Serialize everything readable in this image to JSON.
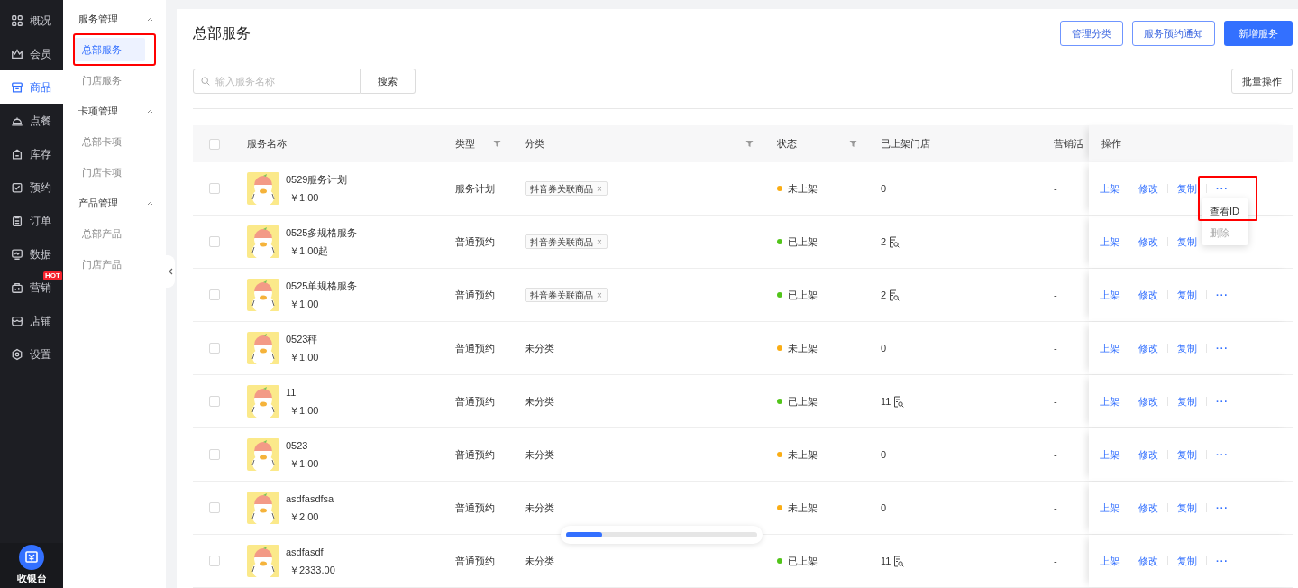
{
  "sidebar": {
    "items": [
      {
        "label": "概况",
        "kind": "grid",
        "selected": false
      },
      {
        "label": "会员",
        "kind": "crown",
        "selected": false
      },
      {
        "label": "商品",
        "kind": "store",
        "selected": true
      },
      {
        "label": "点餐",
        "kind": "bell",
        "selected": false
      },
      {
        "label": "库存",
        "kind": "box",
        "selected": false
      },
      {
        "label": "预约",
        "kind": "calendar",
        "selected": false
      },
      {
        "label": "订单",
        "kind": "clipboard",
        "selected": false
      },
      {
        "label": "数据",
        "kind": "monitor",
        "selected": false
      },
      {
        "label": "营销",
        "kind": "bag",
        "selected": false,
        "badge": "HOT"
      },
      {
        "label": "店铺",
        "kind": "shop",
        "selected": false
      },
      {
        "label": "设置",
        "kind": "gear",
        "selected": false
      }
    ],
    "cashier": {
      "label": "收银台"
    }
  },
  "submenu": {
    "groups": [
      {
        "title": "服务管理",
        "expanded": true,
        "items": [
          {
            "label": "总部服务",
            "selected": true,
            "highlighted": true
          },
          {
            "label": "门店服务",
            "selected": false,
            "highlighted": false
          }
        ]
      },
      {
        "title": "卡项管理",
        "expanded": true,
        "items": [
          {
            "label": "总部卡项",
            "selected": false,
            "highlighted": false
          },
          {
            "label": "门店卡项",
            "selected": false,
            "highlighted": false
          }
        ]
      },
      {
        "title": "产品管理",
        "expanded": true,
        "items": [
          {
            "label": "总部产品",
            "selected": false,
            "highlighted": false
          },
          {
            "label": "门店产品",
            "selected": false,
            "highlighted": false
          }
        ]
      }
    ]
  },
  "page": {
    "title": "总部服务",
    "buttons": [
      {
        "label": "管理分类",
        "primary": false
      },
      {
        "label": "服务预约通知",
        "primary": false
      },
      {
        "label": "新增服务",
        "primary": true
      }
    ],
    "search": {
      "placeholder": "输入服务名称",
      "button": "搜索"
    },
    "batch_button": "批量操作"
  },
  "table": {
    "all_checked": false,
    "columns": [
      {
        "label": "服务名称"
      },
      {
        "label": "类型",
        "filter": true
      },
      {
        "label": "分类",
        "filter": true
      },
      {
        "label": "状态",
        "filter": true
      },
      {
        "label": "已上架门店"
      },
      {
        "label": "营销活"
      },
      {
        "label": "操作"
      }
    ],
    "rows": [
      {
        "checked": false,
        "name": "0529服务计划",
        "price": "￥1.00",
        "type": "服务计划",
        "category": {
          "kind": "tag",
          "text": "抖音券关联商品",
          "close": "×"
        },
        "status": {
          "text": "未上架",
          "color": "#faad14"
        },
        "stores": {
          "text": "0",
          "icon": false
        },
        "marketing": "-",
        "actions": [
          "上架",
          "修改",
          "复制"
        ],
        "more": "···",
        "menu": {
          "highlighted": true,
          "items": [
            {
              "label": "查看ID",
              "disabled": false
            },
            {
              "label": "删除",
              "disabled": true
            }
          ]
        }
      },
      {
        "checked": false,
        "name": "0525多规格服务",
        "price": "￥1.00起",
        "type": "普通预约",
        "category": {
          "kind": "tag",
          "text": "抖音券关联商品",
          "close": "×"
        },
        "status": {
          "text": "已上架",
          "color": "#52c41a"
        },
        "stores": {
          "text": "2",
          "icon": true
        },
        "marketing": "-",
        "actions": [
          "上架",
          "修改",
          "复制"
        ]
      },
      {
        "checked": false,
        "name": "0525单规格服务",
        "price": "￥1.00",
        "type": "普通预约",
        "category": {
          "kind": "tag",
          "text": "抖音券关联商品",
          "close": "×"
        },
        "status": {
          "text": "已上架",
          "color": "#52c41a"
        },
        "stores": {
          "text": "2",
          "icon": true
        },
        "marketing": "-",
        "actions": [
          "上架",
          "修改",
          "复制"
        ],
        "more": "···"
      },
      {
        "checked": false,
        "name": "0523秤",
        "price": "￥1.00",
        "type": "普通预约",
        "category": {
          "kind": "plain",
          "text": "未分类"
        },
        "status": {
          "text": "未上架",
          "color": "#faad14"
        },
        "stores": {
          "text": "0",
          "icon": false
        },
        "marketing": "-",
        "actions": [
          "上架",
          "修改",
          "复制"
        ],
        "more": "···"
      },
      {
        "checked": false,
        "name": "11",
        "price": "￥1.00",
        "type": "普通预约",
        "category": {
          "kind": "plain",
          "text": "未分类"
        },
        "status": {
          "text": "已上架",
          "color": "#52c41a"
        },
        "stores": {
          "text": "11",
          "icon": true
        },
        "marketing": "-",
        "actions": [
          "上架",
          "修改",
          "复制"
        ],
        "more": "···"
      },
      {
        "checked": false,
        "name": "0523",
        "price": "￥1.00",
        "type": "普通预约",
        "category": {
          "kind": "plain",
          "text": "未分类"
        },
        "status": {
          "text": "未上架",
          "color": "#faad14"
        },
        "stores": {
          "text": "0",
          "icon": false
        },
        "marketing": "-",
        "actions": [
          "上架",
          "修改",
          "复制"
        ],
        "more": "···"
      },
      {
        "checked": false,
        "name": "asdfasdfsa",
        "price": "￥2.00",
        "type": "普通预约",
        "category": {
          "kind": "plain",
          "text": "未分类"
        },
        "status": {
          "text": "未上架",
          "color": "#faad14"
        },
        "stores": {
          "text": "0",
          "icon": false
        },
        "marketing": "-",
        "actions": [
          "上架",
          "修改",
          "复制"
        ],
        "more": "···"
      },
      {
        "checked": false,
        "name": "asdfasdf",
        "price": "￥2333.00",
        "type": "普通预约",
        "category": {
          "kind": "plain",
          "text": "未分类"
        },
        "status": {
          "text": "已上架",
          "color": "#52c41a"
        },
        "stores": {
          "text": "11",
          "icon": true
        },
        "marketing": "-",
        "actions": [
          "上架",
          "修改",
          "复制"
        ],
        "more": "···"
      }
    ]
  }
}
